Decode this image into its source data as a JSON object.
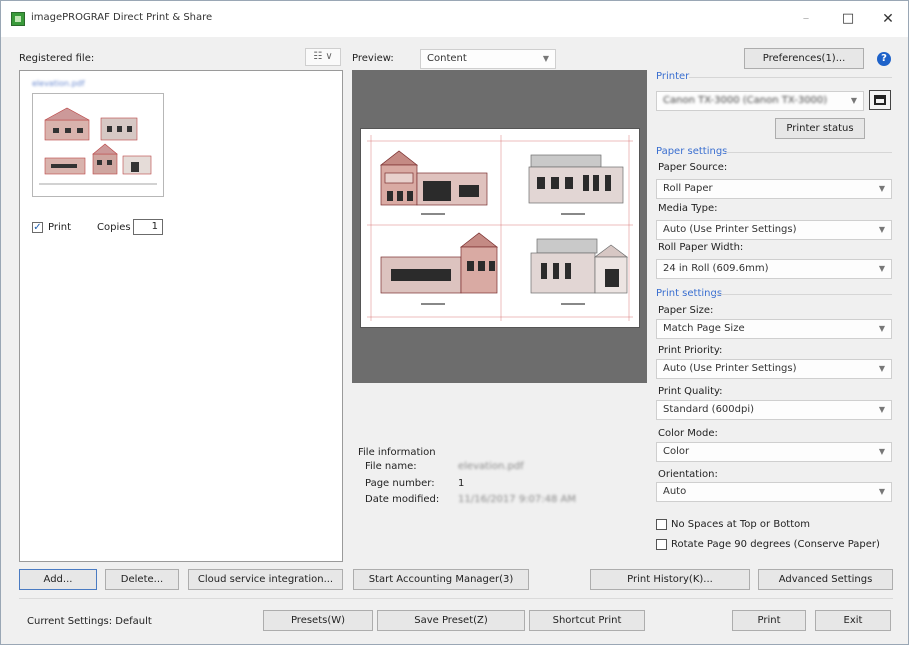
{
  "window": {
    "title": "imagePROGRAF Direct Print & Share",
    "minimize": "–",
    "maximize": "□",
    "close": "✕"
  },
  "left": {
    "registered_label": "Registered file:",
    "view_button": "☷ ∨",
    "file_name": "elevation.pdf",
    "print_label": "Print",
    "copies_label": "Copies",
    "copies_value": "1"
  },
  "preview": {
    "label": "Preview:",
    "mode": "Content"
  },
  "file_info": {
    "title": "File information",
    "file_name_label": "File name:",
    "file_name_value": "elevation.pdf",
    "page_number_label": "Page number:",
    "page_number_value": "1",
    "date_modified_label": "Date modified:",
    "date_modified_value": "11/16/2017 9:07:48 AM"
  },
  "right": {
    "preferences_button": "Preferences(1)...",
    "help_icon": "?",
    "printer_group": "Printer",
    "printer_value": "Canon TX-3000 (Canon TX-3000)",
    "printer_status_button": "Printer status",
    "paper_settings_group": "Paper settings",
    "paper_source_label": "Paper Source:",
    "paper_source_value": "Roll Paper",
    "media_type_label": "Media Type:",
    "media_type_value": "Auto (Use Printer Settings)",
    "roll_width_label": "Roll Paper Width:",
    "roll_width_value": "24 in Roll (609.6mm)",
    "print_settings_group": "Print settings",
    "paper_size_label": "Paper Size:",
    "paper_size_value": "Match Page Size",
    "print_priority_label": "Print Priority:",
    "print_priority_value": "Auto (Use Printer Settings)",
    "print_quality_label": "Print Quality:",
    "print_quality_value": "Standard (600dpi)",
    "color_mode_label": "Color Mode:",
    "color_mode_value": "Color",
    "orientation_label": "Orientation:",
    "orientation_value": "Auto",
    "no_spaces_label": "No Spaces at Top or Bottom",
    "rotate_label": "Rotate Page 90 degrees (Conserve Paper)"
  },
  "buttons_row1": {
    "add": "Add...",
    "delete": "Delete...",
    "cloud": "Cloud service integration...",
    "accounting": "Start Accounting Manager(3)",
    "history": "Print History(K)...",
    "advanced": "Advanced Settings"
  },
  "bottom": {
    "current_settings": "Current Settings: Default",
    "presets": "Presets(W)",
    "save_preset": "Save Preset(Z)",
    "shortcut": "Shortcut Print",
    "print": "Print",
    "exit": "Exit"
  },
  "colors": {
    "group_title": "#3a6fd0",
    "accent_border": "#4a7bc2",
    "help": "#1e62c9",
    "preview_bg": "#6d6d6d"
  }
}
